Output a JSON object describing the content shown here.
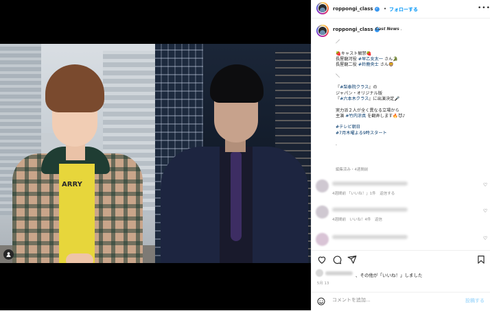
{
  "header": {
    "username": "roppongi_class",
    "follow_label": "フォローする",
    "separator": "•",
    "more": "•••"
  },
  "caption": {
    "username": "roppongi_class",
    "tag": ". 𝘾𝙖𝙨𝙩 𝙉𝙚𝙬𝙨 .",
    "lines": [
      "／",
      "",
      "🍓キャスト解禁🍓",
      "長屋龍河役 #早乙女太一 さん🐊",
      "長屋龍二役 #鈴鹿央士 さん🦁",
      "",
      "＼",
      "",
      "『#梨泰院クラス』の",
      "ジャパン・オリジナル版",
      "『#六本木クラス』に出演決定🎤",
      "",
      "実力派２人が全く異なる立場から",
      "主演 #竹内涼真 を翻弄します🔥😈♪",
      "",
      "#テレビ朝日",
      "#7月木曜よる9時スタート",
      "",
      "."
    ],
    "meta": "編集済み・4週間前"
  },
  "comments": [
    {
      "meta": "4週間前 「いいね！」1件　返信する",
      "heart": "♡"
    },
    {
      "meta": "4週間前　いいね！4件　返信",
      "heart": "♡"
    },
    {
      "meta": "",
      "heart": "♡"
    }
  ],
  "likes": {
    "text": "、その他が「いいね！」しました"
  },
  "date": "5月 13",
  "comment_box": {
    "placeholder": "コメントを追加...",
    "post_label": "投稿する"
  },
  "media": {
    "left_shirt_text": "ARRY"
  },
  "colors": {
    "link": "#0095f6",
    "hashtag": "#00376b",
    "verified": "#3897f0"
  }
}
